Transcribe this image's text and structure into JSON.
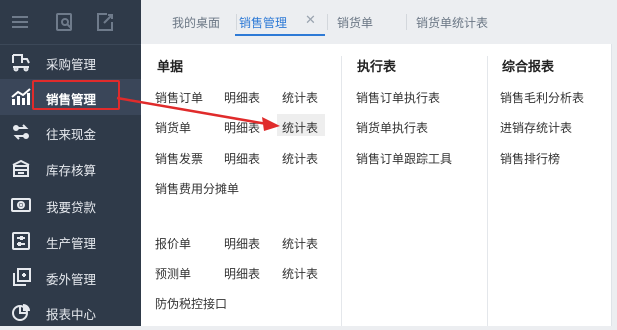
{
  "colors": {
    "sidebar_bg": "#2f3a49",
    "accent": "#2e7ad6",
    "highlight_box": "#e02b2b",
    "arrow": "#e02b2b"
  },
  "topbar_icons": [
    "menu-icon",
    "search-doc-icon",
    "edit-doc-icon"
  ],
  "sidebar": {
    "items": [
      {
        "label": "采购管理",
        "icon": "purchase-icon"
      },
      {
        "label": "销售管理",
        "icon": "sales-chart-icon",
        "active": true
      },
      {
        "label": "往来现金",
        "icon": "cash-exchange-icon"
      },
      {
        "label": "库存核算",
        "icon": "inventory-icon"
      },
      {
        "label": "我要贷款",
        "icon": "loan-icon"
      },
      {
        "label": "生产管理",
        "icon": "production-icon"
      },
      {
        "label": "委外管理",
        "icon": "outsource-icon"
      },
      {
        "label": "报表中心",
        "icon": "report-icon"
      }
    ]
  },
  "tabs": [
    {
      "label": "我的桌面"
    },
    {
      "label": "销售管理",
      "active": true,
      "close": "✕"
    },
    {
      "label": "销货单"
    },
    {
      "label": "销货单统计表"
    }
  ],
  "menu": {
    "documents": {
      "title": "单据",
      "rows": [
        [
          "销售订单",
          "明细表",
          "统计表"
        ],
        [
          "销货单",
          "明细表",
          "统计表"
        ],
        [
          "销售发票",
          "明细表",
          "统计表"
        ],
        [
          "销售费用分摊单"
        ],
        [
          "报价单",
          "明细表",
          "统计表"
        ],
        [
          "预测单",
          "明细表",
          "统计表"
        ],
        [
          "防伪税控接口"
        ]
      ]
    },
    "execution": {
      "title": "执行表",
      "items": [
        "销售订单执行表",
        "销货单执行表",
        "销售订单跟踪工具"
      ]
    },
    "reports": {
      "title": "综合报表",
      "items": [
        "销售毛利分析表",
        "进销存统计表",
        "销售排行榜"
      ]
    }
  }
}
